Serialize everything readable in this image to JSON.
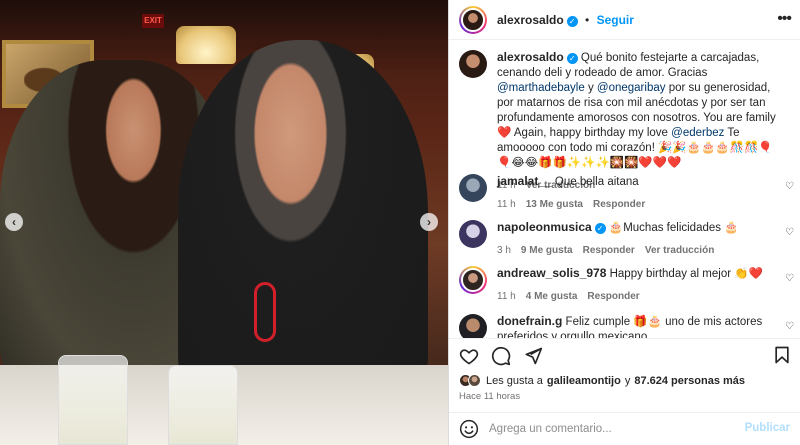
{
  "header": {
    "username": "alexrosaldo",
    "verified_icon": "verified-badge-icon",
    "separator": "•",
    "follow_label": "Seguir",
    "more_icon": "more-options-icon"
  },
  "caption": {
    "username": "alexrosaldo",
    "text_1": "Qué bonito festejarte a carcajadas, cenando deli y rodeado de amor. Gracias",
    "mention_1": "@marthadebayle",
    "text_2": "y",
    "mention_2": "@onegaribay",
    "text_3": "por su generosidad, por matarnos de risa con mil anécdotas y por ser tan profundamente amorosos con nosotros. You are family❤️ Again, happy birthday my love",
    "mention_3": "@ederbez",
    "text_4": "Te amooooo con todo mi corazón! 🎉🎉🎂🎂🎂🎊🎊🎈🎈😂😂🎁🎁✨✨✨🎇🎇❤️❤️❤️",
    "time": "11 h",
    "translate": "Ver traducción"
  },
  "comments": [
    {
      "username": "jamalat__",
      "verified": false,
      "text": "Que bella aitana",
      "time": "11 h",
      "likes": "13 Me gusta",
      "reply": "Responder",
      "translate": ""
    },
    {
      "username": "napoleonmusica",
      "verified": true,
      "text": "🎂Muchas felicidades 🎂",
      "time": "3 h",
      "likes": "9 Me gusta",
      "reply": "Responder",
      "translate": "Ver traducción"
    },
    {
      "username": "andreaw_solis_978",
      "verified": false,
      "text": "Happy birthday al mejor 👏❤️",
      "time": "11 h",
      "likes": "4 Me gusta",
      "reply": "Responder",
      "translate": ""
    },
    {
      "username": "donefrain.g",
      "verified": false,
      "text": "Feliz cumple 🎁🎂 uno de mis actores preferidos y orgullo mexicano",
      "time": "",
      "likes": "",
      "reply": "",
      "translate": ""
    }
  ],
  "actions": {
    "like_icon": "heart-icon",
    "comment_icon": "comment-icon",
    "share_icon": "share-icon",
    "save_icon": "bookmark-icon"
  },
  "likes": {
    "prefix": "Les gusta a",
    "user": "galileamontijo",
    "middle": "y",
    "count": "87.624 personas más"
  },
  "posted": "Hace 11 horas",
  "comment_box": {
    "placeholder": "Agrega un comentario...",
    "publish": "Publicar",
    "emoji_icon": "emoji-icon"
  },
  "photo": {
    "exit_sign": "EXIT",
    "prev_icon": "chevron-left-icon",
    "next_icon": "chevron-right-icon"
  }
}
